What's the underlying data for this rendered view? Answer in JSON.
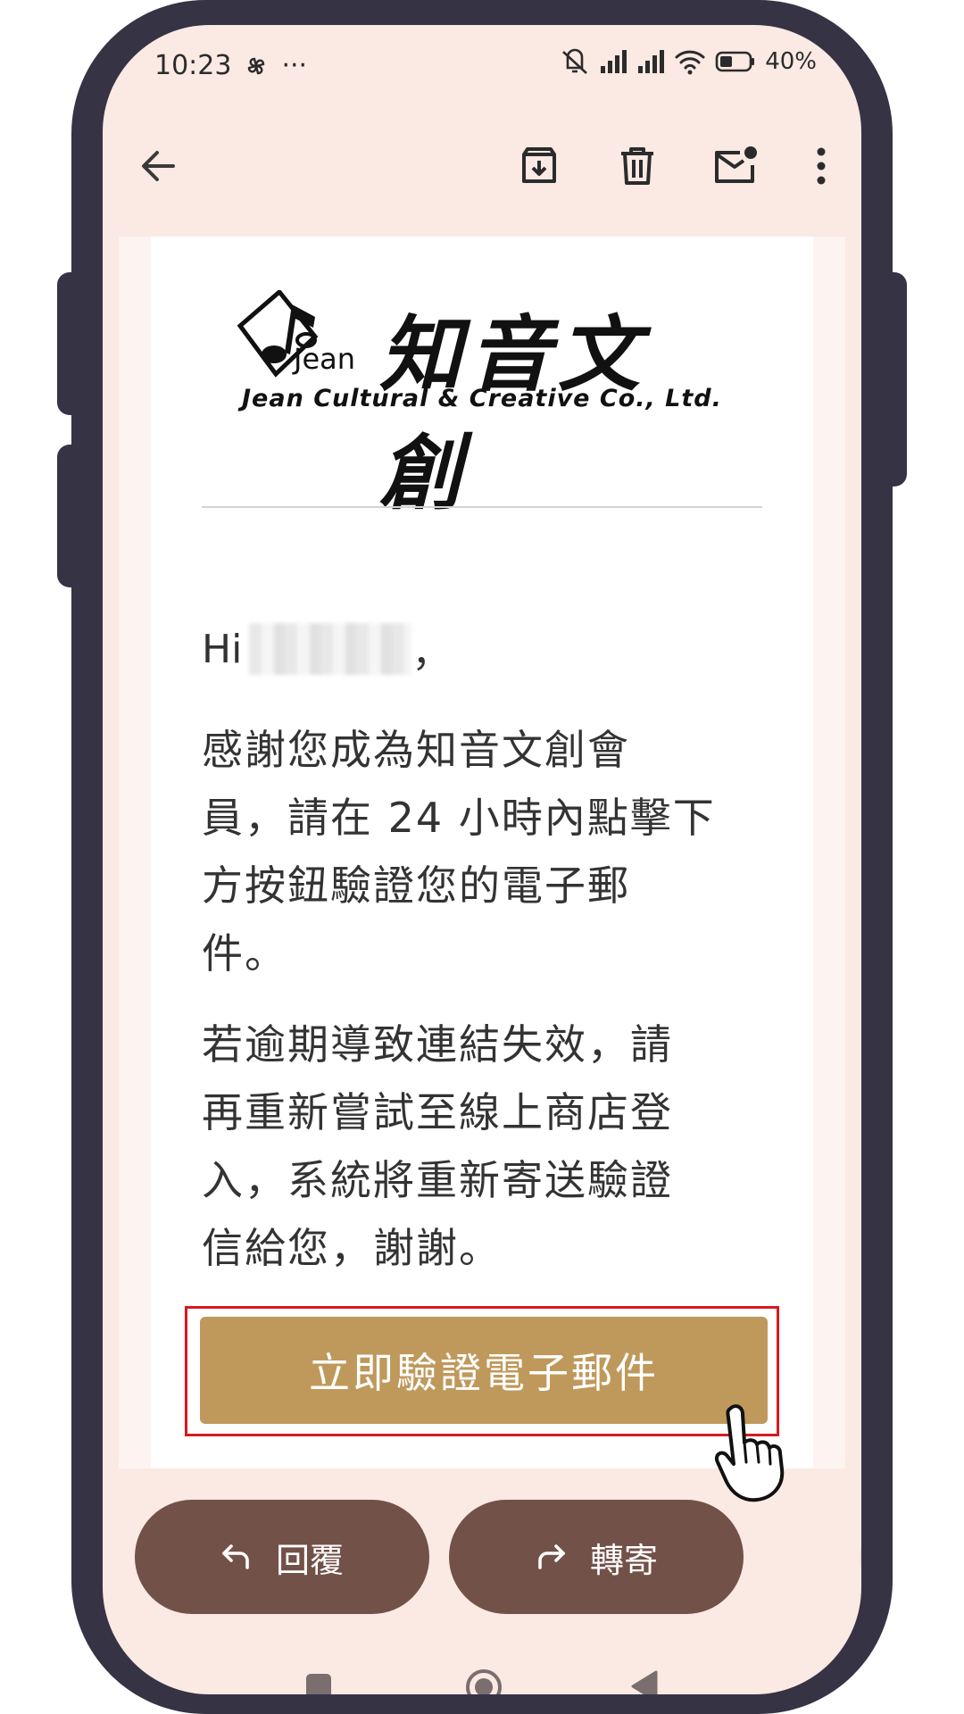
{
  "status_bar": {
    "time": "10:23",
    "battery": "40%"
  },
  "toolbar": {
    "back_icon": "arrow-left-icon",
    "archive_icon": "archive-icon",
    "delete_icon": "trash-icon",
    "mark_unread_icon": "mail-unread-icon",
    "more_icon": "more-vert-icon"
  },
  "email": {
    "logo_cn": "知音文創",
    "logo_jean": "Jean",
    "logo_en": "Jean Cultural & Creative Co., Ltd.",
    "greeting_prefix": "Hi",
    "greeting_suffix": "，",
    "paragraph1_lines": [
      "感謝您成為知音文創會",
      "員，請在 24 小時內點擊下",
      "方按鈕驗證您的電子郵",
      "件。"
    ],
    "paragraph2_lines": [
      "若逾期導致連結失效，請",
      "再重新嘗試至線上商店登",
      "入，系統將重新寄送驗證",
      "信給您，謝謝。"
    ],
    "verify_button": "立即驗證電子郵件"
  },
  "actions": {
    "reply": "回覆",
    "forward": "轉寄"
  },
  "colors": {
    "screen_bg": "#fbe9e4",
    "verify_button": "#bf995b",
    "action_button": "#725149",
    "highlight_outline": "#d81920",
    "phone_frame": "#363345"
  }
}
